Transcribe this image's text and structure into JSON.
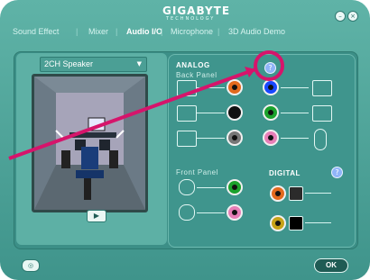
{
  "window": {
    "brand": "GIGABYTE",
    "brand_tag": "TECHNOLOGY"
  },
  "tabs": [
    {
      "label": "Sound Effect"
    },
    {
      "label": "Mixer"
    },
    {
      "label": "Audio I/O"
    },
    {
      "label": "Microphone"
    },
    {
      "label": "3D Audio Demo"
    }
  ],
  "active_tab_index": 2,
  "left_panel": {
    "speaker_mode": "2CH Speaker"
  },
  "analog": {
    "label": "ANALOG",
    "back_panel_label": "Back Panel",
    "front_panel_label": "Front Panel",
    "help_icon": "question-icon"
  },
  "digital": {
    "label": "DIGITAL",
    "help_icon": "question-icon"
  },
  "footer": {
    "ok_label": "OK"
  },
  "colors": {
    "accent_pink": "#d6146b",
    "jack_orange": "#e26a1e",
    "jack_blue": "#1948ff",
    "jack_black": "#111111",
    "jack_green": "#1ba22c",
    "jack_pink": "#e77eb7",
    "jack_gray": "#777777"
  }
}
